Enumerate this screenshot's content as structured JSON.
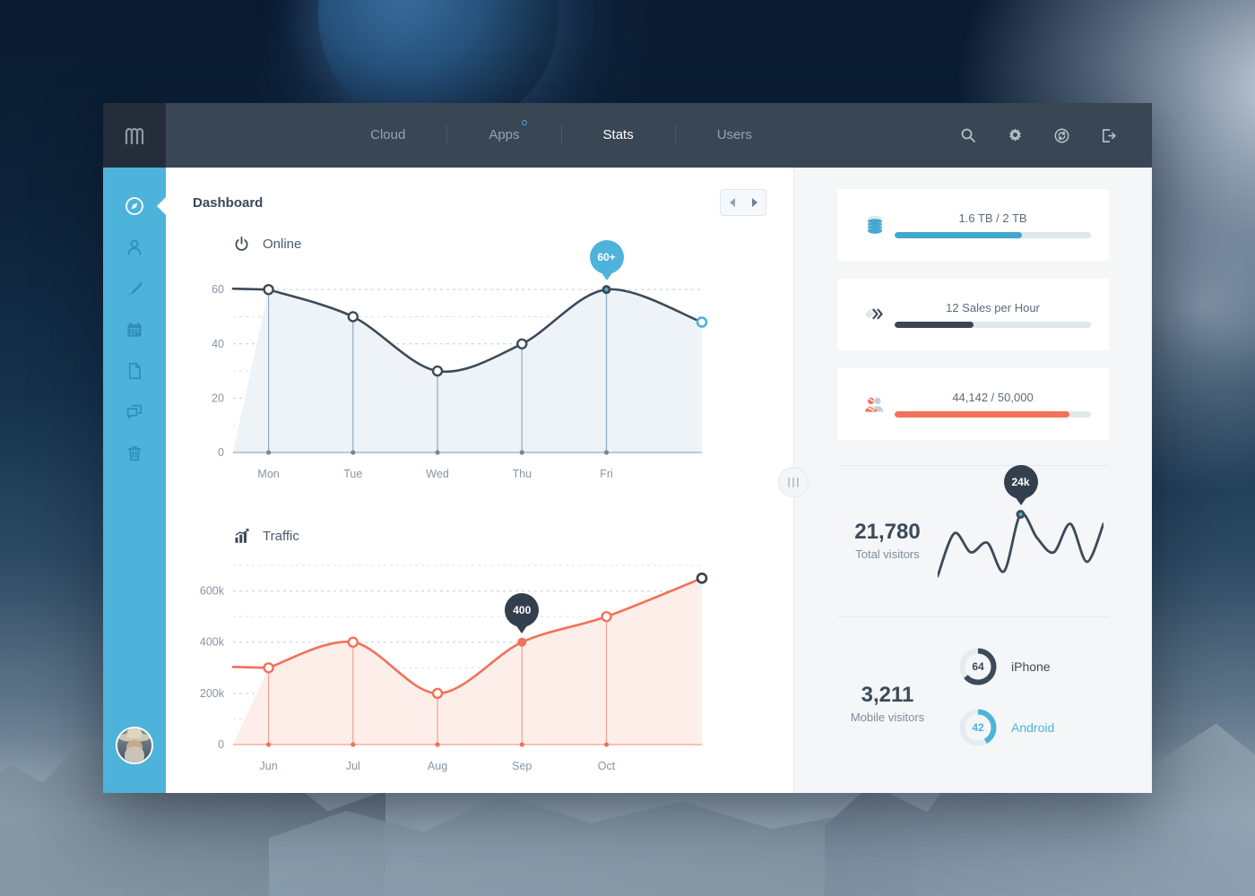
{
  "topbar": {
    "logo_icon": "mountain-logo-icon",
    "nav": [
      {
        "label": "Cloud",
        "active": false,
        "badge": false
      },
      {
        "label": "Apps",
        "active": false,
        "badge": true
      },
      {
        "label": "Stats",
        "active": true,
        "badge": false
      },
      {
        "label": "Users",
        "active": false,
        "badge": false
      }
    ],
    "actions": [
      {
        "name": "search-icon"
      },
      {
        "name": "gear-icon"
      },
      {
        "name": "sync-icon"
      },
      {
        "name": "logout-icon"
      }
    ]
  },
  "sidebar": {
    "items": [
      {
        "name": "compass-icon",
        "active": true
      },
      {
        "name": "user-icon",
        "active": false
      },
      {
        "name": "pen-icon",
        "active": false
      },
      {
        "name": "calendar-icon",
        "active": false
      },
      {
        "name": "document-icon",
        "active": false
      },
      {
        "name": "chat-icon",
        "active": false
      },
      {
        "name": "trash-icon",
        "active": false
      }
    ],
    "avatar_name": "user-avatar"
  },
  "main": {
    "page_title": "Dashboard",
    "pager": {
      "prev": "◀",
      "next": "▶"
    },
    "handle_name": "panel-resize-handle"
  },
  "chart_data": [
    {
      "type": "area",
      "title": "Online",
      "icon": "power-icon",
      "categories": [
        "Mon",
        "Tue",
        "Wed",
        "Thu",
        "Fri"
      ],
      "values": [
        60,
        50,
        30,
        40,
        60
      ],
      "trailing_value": 48,
      "xlabel": "",
      "ylabel": "",
      "yticks": [
        0,
        20,
        40,
        60
      ],
      "ylim": [
        0,
        66
      ],
      "grid": true,
      "legend": "none",
      "annotation": {
        "label": "60+",
        "at_category": "Fri",
        "value": 60
      },
      "line_color": "#3d4a59",
      "fill_color": "#eef3f8",
      "accent_color": "#4eb3da"
    },
    {
      "type": "area",
      "title": "Traffic",
      "icon": "bar-chart-icon",
      "categories": [
        "Jun",
        "Jul",
        "Aug",
        "Sep",
        "Oct"
      ],
      "values": [
        300000,
        400000,
        200000,
        400000,
        500000
      ],
      "trailing_value": 650000,
      "xlabel": "",
      "ylabel": "",
      "yticks": [
        0,
        200000,
        400000,
        600000
      ],
      "ytick_labels": [
        "0",
        "200k",
        "400k",
        "600k"
      ],
      "ylim": [
        0,
        700000
      ],
      "grid": true,
      "legend": "none",
      "annotation": {
        "label": "400",
        "at_category": "Sep",
        "value": 400000
      },
      "line_color": "#f3705a",
      "fill_color": "#fdeeea",
      "accent_color": "#f3705a"
    },
    {
      "type": "line",
      "title": "Total visitors sparkline",
      "values": [
        8,
        26,
        18,
        22,
        10,
        34,
        24,
        18,
        30,
        14,
        30
      ],
      "annotation": {
        "label": "24k",
        "value": 24
      },
      "line_color": "#3c4a5a"
    }
  ],
  "right": {
    "cards": [
      {
        "icon": "database-icon",
        "label": "1.6 TB / 2 TB",
        "percent": 65,
        "color": "#42a7cf"
      },
      {
        "icon": "sales-tag-icon",
        "label": "12 Sales per Hour",
        "percent": 40,
        "color": "#3b4756"
      },
      {
        "icon": "visitors-icon",
        "label": "44,142 / 50,000",
        "percent": 89,
        "color": "#f3705a"
      }
    ],
    "visitors": {
      "number": "21,780",
      "caption": "Total visitors",
      "spark_badge": "24k"
    },
    "mobile": {
      "number": "3,211",
      "caption": "Mobile visitors",
      "donuts": [
        {
          "label": "iPhone",
          "value": "64",
          "percent": 64,
          "color": "#3c4a5a",
          "track": "#e3edf1",
          "text_color": "#3c4a5a"
        },
        {
          "label": "Android",
          "value": "42",
          "percent": 42,
          "color": "#4eb3da",
          "track": "#e3edf1",
          "text_color": "#4eb3da"
        }
      ]
    }
  }
}
